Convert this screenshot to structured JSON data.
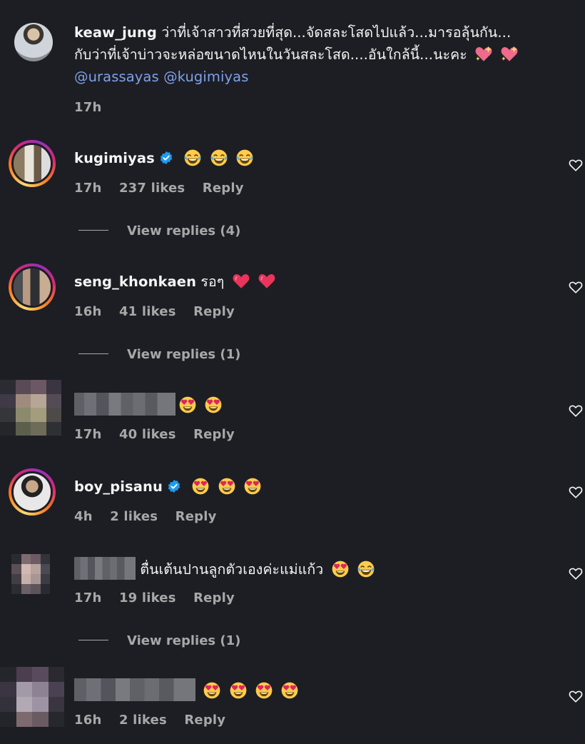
{
  "caption": {
    "username": "keaw_jung",
    "text_line1": "ว่าที่เจ้าสาวที่สวยที่สุด...จัดสละโสดไปแล้ว...มารอลุ้นกัน...",
    "text_line2": "กับว่าที่เจ้าบ่าวจะหล่อขนาดไหนในวันสละโสด....อันใกล้นี้...นะคะ",
    "mention1": "@urassayas",
    "mention2": "@kugimiyas",
    "time": "17h"
  },
  "comments": [
    {
      "username": "kugimiyas",
      "verified": true,
      "text": "",
      "emojis": [
        "joy",
        "joy",
        "joy"
      ],
      "time": "17h",
      "likes": "237 likes",
      "reply": "Reply",
      "view_replies": "View replies (4)"
    },
    {
      "username": "seng_khonkaen",
      "verified": false,
      "text": "รอๆ",
      "emojis": [
        "heart",
        "heart"
      ],
      "time": "16h",
      "likes": "41 likes",
      "reply": "Reply",
      "view_replies": "View replies (1)"
    },
    {
      "username": "",
      "verified": false,
      "text": "",
      "emojis": [
        "heart-eyes",
        "heart-eyes"
      ],
      "time": "17h",
      "likes": "40 likes",
      "reply": "Reply",
      "view_replies": ""
    },
    {
      "username": "boy_pisanu",
      "verified": true,
      "text": "",
      "emojis": [
        "heart-eyes",
        "heart-eyes",
        "heart-eyes"
      ],
      "time": "4h",
      "likes": "2 likes",
      "reply": "Reply",
      "view_replies": ""
    },
    {
      "username": "",
      "verified": false,
      "text": "ตื่นเต้นปานลูกตัวเองค่ะแม่แก้ว",
      "emojis": [
        "heart-eyes",
        "joy"
      ],
      "time": "17h",
      "likes": "19 likes",
      "reply": "Reply",
      "view_replies": "View replies (1)"
    },
    {
      "username": "",
      "verified": false,
      "text": "",
      "emojis": [
        "heart-eyes",
        "heart-eyes",
        "heart-eyes",
        "heart-eyes"
      ],
      "time": "16h",
      "likes": "2 likes",
      "reply": "Reply",
      "view_replies": ""
    }
  ],
  "icons": {
    "like": "heart-outline-icon",
    "verified": "verified-badge-icon"
  },
  "colors": {
    "background": "#1c1e23",
    "mention": "#7fa0ea",
    "meta": "#a8a8a8",
    "verified": "#1d9bf0"
  }
}
